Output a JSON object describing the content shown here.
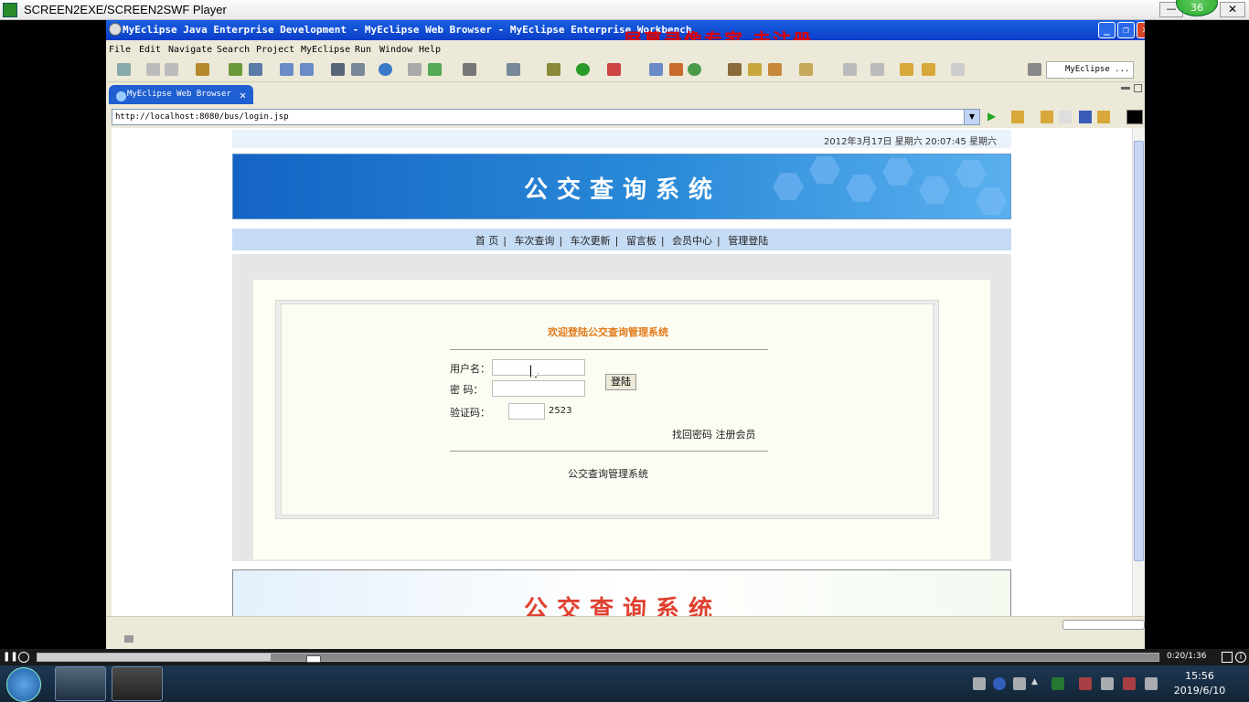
{
  "player": {
    "title": "SCREEN2EXE/SCREEN2SWF Player",
    "badge": "36",
    "min": "—",
    "close": "✕"
  },
  "eclipse": {
    "title": "MyEclipse Java Enterprise Development - MyEclipse Web Browser - MyEclipse Enterprise Workbench",
    "watermark": "屏幕录像专家  未注册",
    "menu": [
      "File",
      "Edit",
      "Navigate",
      "Search",
      "Project",
      "MyEclipse",
      "Run",
      "Window",
      "Help"
    ],
    "perspective": "MyEclipse ...",
    "tab": {
      "label": "MyEclipse Web Browser",
      "close": "✕"
    },
    "address": "http://localhost:8080/bus/login.jsp"
  },
  "page": {
    "datetime": "2012年3月17日 星期六 20:07:45  星期六",
    "banner_title": "公交查询系统",
    "nav": [
      "首 页",
      "车次查询",
      "车次更新",
      "留言板",
      "会员中心",
      "管理登陆"
    ],
    "login": {
      "title": "欢迎登陆公交查询管理系统",
      "username_label": "用户名：",
      "password_label": "密  码：",
      "captcha_label": "验证码：",
      "captcha_value": "2523",
      "login_button": "登陆",
      "forgot": "找回密码",
      "register": "注册会员",
      "footer": "公交查询管理系统"
    },
    "footer_banner": "公交查询系统"
  },
  "controls": {
    "time": "0:20/1:36",
    "progress": 0.208
  },
  "taskbar": {
    "time": "15:56",
    "date": "2019/6/10"
  }
}
